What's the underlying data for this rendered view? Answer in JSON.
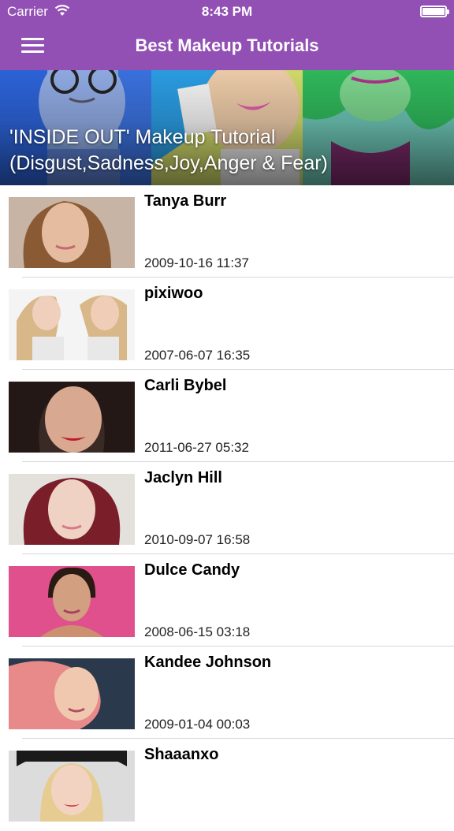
{
  "status_bar": {
    "carrier": "Carrier",
    "time": "8:43 PM",
    "wifi_icon": "wifi-icon",
    "battery_icon": "battery-icon"
  },
  "nav": {
    "title": "Best Makeup Tutorials",
    "menu_icon": "hamburger-menu-icon",
    "color": "#9250b4"
  },
  "featured": {
    "title_line1": "'INSIDE OUT' Makeup Tutorial",
    "title_line2": "(Disgust,Sadness,Joy,Anger & Fear)"
  },
  "channels": [
    {
      "name": "Tanya Burr",
      "date": "2009-10-16 11:37"
    },
    {
      "name": "pixiwoo",
      "date": "2007-06-07 16:35"
    },
    {
      "name": "Carli Bybel",
      "date": "2011-06-27 05:32"
    },
    {
      "name": "Jaclyn Hill",
      "date": "2010-09-07 16:58"
    },
    {
      "name": "Dulce Candy",
      "date": "2008-06-15 03:18"
    },
    {
      "name": "Kandee Johnson",
      "date": "2009-01-04 00:03"
    },
    {
      "name": "Shaaanxo",
      "date": ""
    }
  ]
}
